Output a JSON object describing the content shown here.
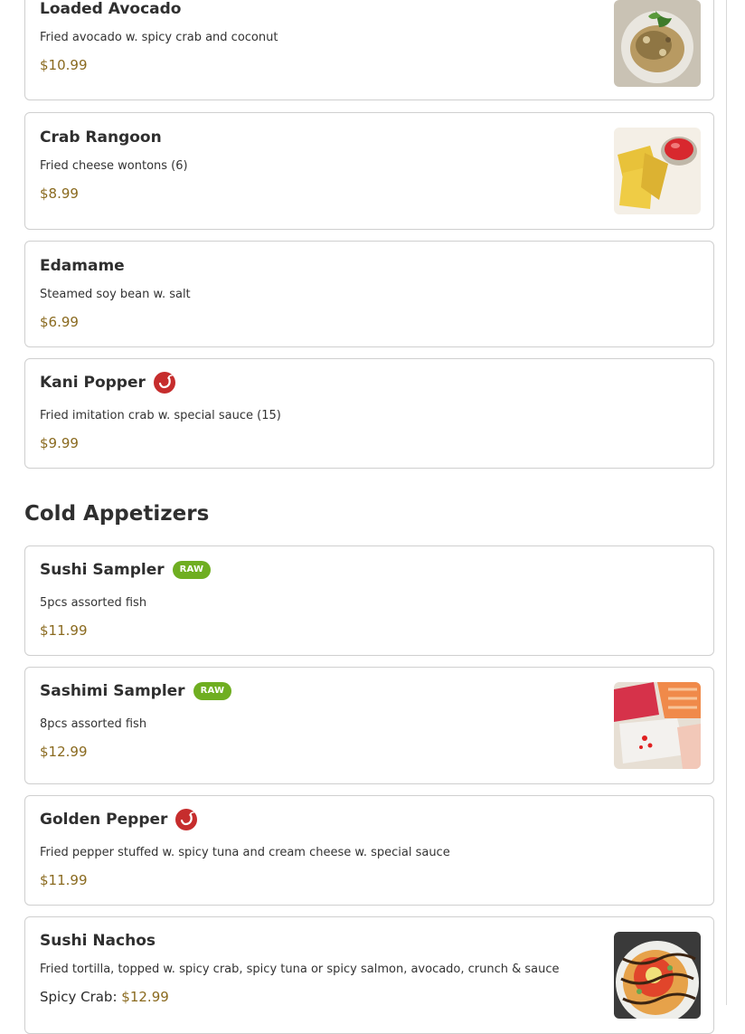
{
  "section": {
    "title": "Cold Appetizers"
  },
  "colors": {
    "price": "#8a6a1f",
    "raw_badge": "#6fae21",
    "spicy": "#c62d2d"
  },
  "items": [
    {
      "name": "Loaded Avocado",
      "desc": "Fried avocado w. spicy crab and coconut",
      "price": "$10.99",
      "image": "loaded-avocado-photo"
    },
    {
      "name": "Crab Rangoon",
      "desc": "Fried cheese wontons (6)",
      "price": "$8.99",
      "image": "crab-rangoon-photo"
    },
    {
      "name": "Edamame",
      "desc": "Steamed soy bean w. salt",
      "price": "$6.99"
    },
    {
      "name": "Kani Popper",
      "desc": "Fried imitation crab w. special sauce (15)",
      "price": "$9.99",
      "icon": "spicy-icon"
    },
    {
      "name": "Sushi Sampler",
      "desc": "5pcs assorted fish",
      "price": "$11.99",
      "badge": "RAW"
    },
    {
      "name": "Sashimi Sampler",
      "desc": "8pcs assorted fish",
      "price": "$12.99",
      "badge": "RAW",
      "image": "sashimi-sampler-photo"
    },
    {
      "name": "Golden Pepper",
      "desc": "Fried pepper stuffed w. spicy tuna and cream cheese w. special sauce",
      "price": "$11.99",
      "icon": "spicy-icon"
    },
    {
      "name": "Sushi Nachos",
      "desc": "Fried tortilla, topped w. spicy crab, spicy tuna or spicy salmon, avocado, crunch & sauce",
      "price_label": "Spicy Crab:",
      "price": "$12.99",
      "image": "sushi-nachos-photo"
    }
  ]
}
